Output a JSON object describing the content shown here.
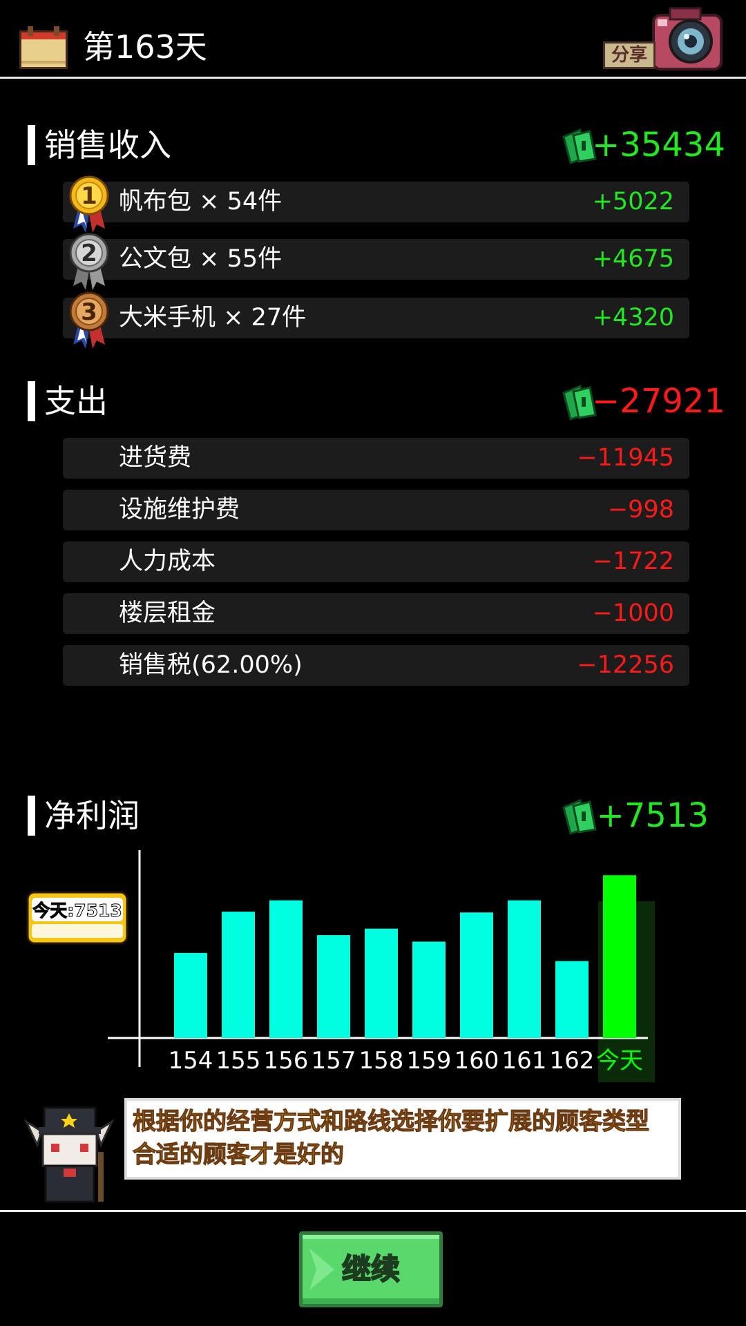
{
  "header": {
    "day_title": "第163天",
    "share_label": "分享"
  },
  "sales": {
    "title": "销售收入",
    "total": "+35434",
    "items": [
      {
        "rank": "1",
        "label": "帆布包 × 54件",
        "value": "+5022"
      },
      {
        "rank": "2",
        "label": "公文包 × 55件",
        "value": "+4675"
      },
      {
        "rank": "3",
        "label": "大米手机 × 27件",
        "value": "+4320"
      }
    ]
  },
  "expenses": {
    "title": "支出",
    "total": "−27921",
    "items": [
      {
        "label": "进货费",
        "value": "−11945"
      },
      {
        "label": "设施维护费",
        "value": "−998"
      },
      {
        "label": "人力成本",
        "value": "−1722"
      },
      {
        "label": "楼层租金",
        "value": "−1000"
      },
      {
        "label": "销售税(62.00%)",
        "value": "−12256"
      }
    ]
  },
  "profit": {
    "title": "净利润",
    "total": "+7513",
    "today_tag": "今天:7513"
  },
  "chart_data": {
    "type": "bar",
    "categories": [
      "154",
      "155",
      "156",
      "157",
      "158",
      "159",
      "160",
      "161",
      "162",
      "今天"
    ],
    "values": [
      5250,
      7800,
      8500,
      6350,
      6750,
      5950,
      7750,
      8500,
      4750,
      10050
    ],
    "highlight_index": 9,
    "bar_color": "#00ffe0",
    "highlight_color": "#00ff00",
    "ylim": [
      0,
      11000
    ]
  },
  "tip": {
    "line1": "根据你的经营方式和路线选择你要扩展的顾客类型",
    "line2": "合适的顾客才是好的"
  },
  "footer": {
    "continue_label": "继续"
  },
  "colors": {
    "positive": "#22e822",
    "negative": "#ff1a1a",
    "row_bg": "#1c1c1c"
  }
}
